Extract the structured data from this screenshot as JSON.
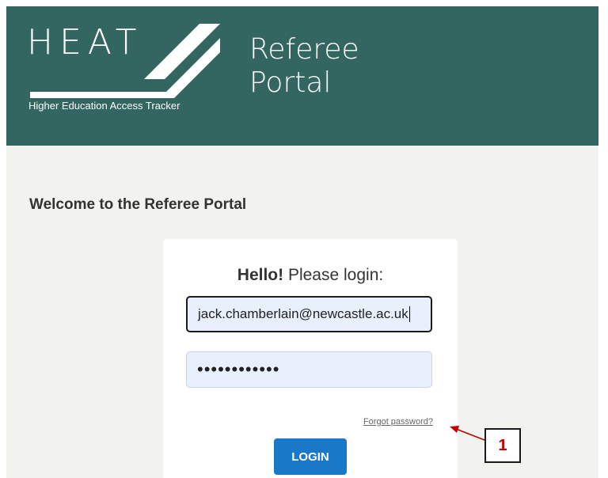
{
  "header": {
    "logo_text": "HEAT",
    "logo_subtitle": "Higher Education Access Tracker",
    "portal_title_line1": "Referee",
    "portal_title_line2": "Portal",
    "background_color": "#336661"
  },
  "main": {
    "welcome": "Welcome to the Referee Portal",
    "greeting_bold": "Hello!",
    "greeting_rest": " Please login:",
    "email_value": "jack.chamberlain@newcastle.ac.uk",
    "password_mask": "••••••••••••",
    "forgot_link": "Forgot password?",
    "login_button": "LOGIN",
    "button_color": "#1a78c9"
  },
  "annotation": {
    "label": "1",
    "color": "#c00000"
  }
}
